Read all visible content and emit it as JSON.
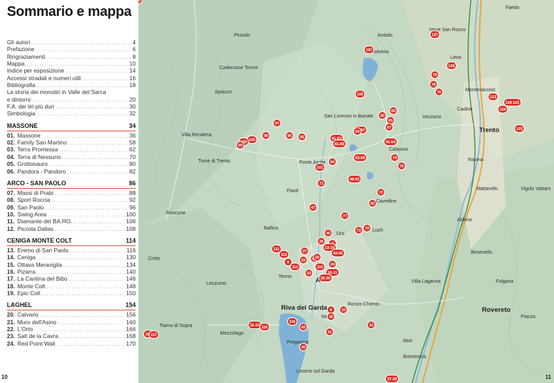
{
  "index": {
    "title": "Sommario e mappa",
    "front": [
      {
        "label": "Gli autori",
        "page": "4"
      },
      {
        "label": "Prefazione",
        "page": "6"
      },
      {
        "label": "Ringraziamenti",
        "page": "8"
      },
      {
        "label": "Mappa",
        "page": "10"
      },
      {
        "label": "Indice per esposizione",
        "page": "14"
      },
      {
        "label": "Accessi stradali e numeri utili",
        "page": "16"
      },
      {
        "label": "Bibliografia",
        "page": "18"
      },
      {
        "label": "La storia dei monotiri in Valle del Sarca",
        "page": ""
      },
      {
        "label": "e dintorni",
        "page": "20"
      },
      {
        "label": "F.A. dei tiri più duri",
        "page": "30"
      },
      {
        "label": "Simbologia",
        "page": "32"
      }
    ],
    "sections": [
      {
        "title": "MASSONE",
        "page": "34",
        "items": [
          {
            "num": "01.",
            "label": "Massone",
            "page": "36"
          },
          {
            "num": "02.",
            "label": "Family San Martino",
            "page": "58"
          },
          {
            "num": "03.",
            "label": "Terra Promessa",
            "page": "62"
          },
          {
            "num": "04.",
            "label": "Terra di Nessuno",
            "page": "70"
          },
          {
            "num": "05.",
            "label": "Grottosauro",
            "page": "80"
          },
          {
            "num": "06.",
            "label": "Pandora - Pandoro",
            "page": "82"
          }
        ]
      },
      {
        "title": "ARCO - SAN PAOLO",
        "page": "86",
        "items": [
          {
            "num": "07.",
            "label": "Massi di Prabi",
            "page": "88"
          },
          {
            "num": "08.",
            "label": "Sport Roccia",
            "page": "92"
          },
          {
            "num": "09.",
            "label": "San Paolo",
            "page": "96"
          },
          {
            "num": "10.",
            "label": "Swing Area",
            "page": "100"
          },
          {
            "num": "11.",
            "label": "Diamante del BA.RO.",
            "page": "106"
          },
          {
            "num": "12.",
            "label": "Piccola Dallas",
            "page": "108"
          }
        ]
      },
      {
        "title": "CENIGA MONTE COLT",
        "page": "114",
        "items": [
          {
            "num": "13.",
            "label": "Eremo di San Paolo",
            "page": "116"
          },
          {
            "num": "14.",
            "label": "Ceniga",
            "page": "130"
          },
          {
            "num": "15.",
            "label": "Ottava Meraviglia",
            "page": "134"
          },
          {
            "num": "16.",
            "label": "Pizarra",
            "page": "140"
          },
          {
            "num": "17.",
            "label": "La Cantina del Bibo",
            "page": "146"
          },
          {
            "num": "18.",
            "label": "Monte Colt",
            "page": "148"
          },
          {
            "num": "19.",
            "label": "Epic Colt",
            "page": "150"
          }
        ]
      },
      {
        "title": "LAGHEL",
        "page": "154",
        "items": [
          {
            "num": "20.",
            "label": "Calvario",
            "page": "156"
          },
          {
            "num": "21.",
            "label": "Muro dell'Asino",
            "page": "160"
          },
          {
            "num": "22.",
            "label": "L'Orto",
            "page": "166"
          },
          {
            "num": "23.",
            "label": "Salt de la Cavra",
            "page": "168"
          },
          {
            "num": "24.",
            "label": "Red Point Wall",
            "page": "170"
          }
        ]
      }
    ],
    "left_page_number": "10"
  },
  "map": {
    "right_page_number": "11",
    "colors": {
      "marker": "#d8352a",
      "lake": "#7fb2d6",
      "road": "#e8a83a",
      "railway": "#2a8a3a",
      "terrain": "#c9dbc7"
    },
    "places": [
      {
        "name": "Faedo",
        "size": "small"
      },
      {
        "name": "Andalo",
        "size": "small"
      },
      {
        "name": "Nave San Rocco",
        "size": "small"
      },
      {
        "name": "Pinzolo",
        "size": "small"
      },
      {
        "name": "Molveno",
        "size": "small"
      },
      {
        "name": "Lavis",
        "size": "small"
      },
      {
        "name": "Caderzone Terme",
        "size": "small"
      },
      {
        "name": "Montevaccino",
        "size": "small"
      },
      {
        "name": "Spiazzo",
        "size": "small"
      },
      {
        "name": "Cadine",
        "size": "small"
      },
      {
        "name": "San Lorenzo in Banale",
        "size": "small"
      },
      {
        "name": "Vezzano",
        "size": "small"
      },
      {
        "name": "Trento",
        "size": "big"
      },
      {
        "name": "Villa Rendena",
        "size": "small"
      },
      {
        "name": "Calavino",
        "size": "small"
      },
      {
        "name": "Tione di Trento",
        "size": "small"
      },
      {
        "name": "Ponte Arche",
        "size": "small"
      },
      {
        "name": "Ravina",
        "size": "small"
      },
      {
        "name": "Fiavè",
        "size": "small"
      },
      {
        "name": "Cavedine",
        "size": "small"
      },
      {
        "name": "Mattarello",
        "size": "small"
      },
      {
        "name": "Vigolo Vattaro",
        "size": "small"
      },
      {
        "name": "Roncone",
        "size": "small"
      },
      {
        "name": "Ballino",
        "size": "small"
      },
      {
        "name": "Dro",
        "size": "small"
      },
      {
        "name": "Luch",
        "size": "small"
      },
      {
        "name": "Aldeno",
        "size": "small"
      },
      {
        "name": "Creto",
        "size": "small"
      },
      {
        "name": "Besenello",
        "size": "small"
      },
      {
        "name": "Tenno",
        "size": "small"
      },
      {
        "name": "Arco",
        "size": "big"
      },
      {
        "name": "Lenzumo",
        "size": "small"
      },
      {
        "name": "Villa Lagarina",
        "size": "small"
      },
      {
        "name": "Folgaria",
        "size": "small"
      },
      {
        "name": "Riva del Garda",
        "size": "big"
      },
      {
        "name": "Tiarno di Sopra",
        "size": "small"
      },
      {
        "name": "Ronzo-Chienis",
        "size": "small"
      },
      {
        "name": "Rovereto",
        "size": "big"
      },
      {
        "name": "Mezzolago",
        "size": "small"
      },
      {
        "name": "Nago",
        "size": "small"
      },
      {
        "name": "Piazza",
        "size": "small"
      },
      {
        "name": "Mori",
        "size": "small"
      },
      {
        "name": "Pregasina",
        "size": "small"
      },
      {
        "name": "Brentonico",
        "size": "small"
      },
      {
        "name": "Limone sul Garda",
        "size": "small"
      }
    ],
    "markers": [
      "127",
      "187",
      "128",
      "79",
      "78",
      "76",
      "105",
      "90",
      "60",
      "65",
      "67",
      "86-87",
      "122",
      "118-121",
      "124",
      "125",
      "97",
      "98",
      "96",
      "95",
      "102",
      "100",
      "99",
      "91-93",
      "69",
      "81-85",
      "74",
      "75",
      "41-64",
      "53-58",
      "94",
      "101",
      "48-52",
      "71",
      "72",
      "92",
      "47",
      "77",
      "70",
      "73",
      "46",
      "26",
      "2",
      "13-19",
      "111",
      "112",
      "27",
      "89",
      "43-45",
      "110",
      "113",
      "24",
      "20",
      "22",
      "9",
      "23",
      "10-11",
      "25-30",
      "8",
      "33",
      "36",
      "32",
      "41",
      "42",
      "31-33",
      "115",
      "114",
      "117",
      "116",
      "40",
      "37-39",
      "21"
    ]
  }
}
